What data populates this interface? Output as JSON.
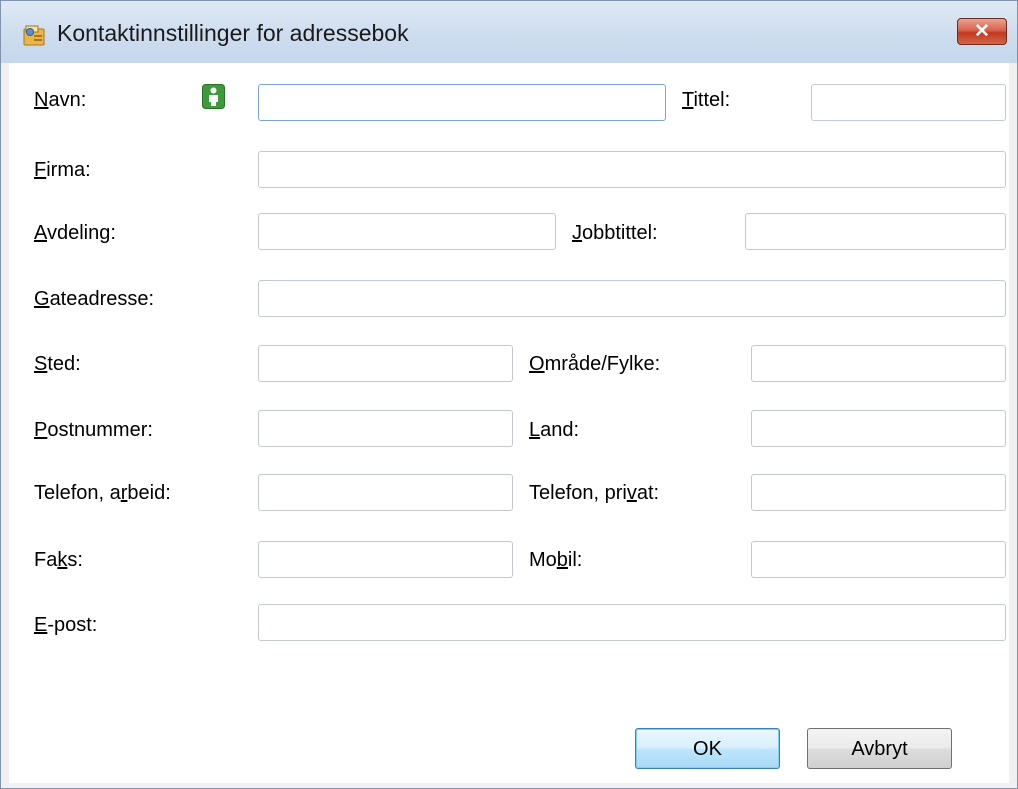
{
  "window": {
    "title": "Kontaktinnstillinger for adressebok",
    "close_label": "✕",
    "title_icon": "address-book-icon"
  },
  "form": {
    "navn": {
      "pre": "",
      "acc": "N",
      "post": "avn:"
    },
    "tittel": {
      "pre": "",
      "acc": "T",
      "post": "ittel:"
    },
    "firma": {
      "pre": "",
      "acc": "F",
      "post": "irma:"
    },
    "avdeling": {
      "pre": "",
      "acc": "A",
      "post": "vdeling:"
    },
    "jobbtittel": {
      "pre": "",
      "acc": "J",
      "post": "obbtittel:"
    },
    "gateadresse": {
      "pre": "",
      "acc": "G",
      "post": "ateadresse:"
    },
    "sted": {
      "pre": "",
      "acc": "S",
      "post": "ted:"
    },
    "omrade": {
      "pre": "",
      "acc": "O",
      "post": "mråde/Fylke:"
    },
    "postnummer": {
      "pre": "",
      "acc": "P",
      "post": "ostnummer:"
    },
    "land": {
      "pre": "",
      "acc": "L",
      "post": "and:"
    },
    "tlf_arbeid": {
      "pre": "Telefon, a",
      "acc": "r",
      "post": "beid:"
    },
    "tlf_privat": {
      "pre": "Telefon, pri",
      "acc": "v",
      "post": "at:"
    },
    "faks": {
      "pre": "Fa",
      "acc": "k",
      "post": "s:"
    },
    "mobil": {
      "pre": "Mo",
      "acc": "b",
      "post": "il:"
    },
    "epost": {
      "pre": "",
      "acc": "E",
      "post": "-post:"
    },
    "values": {
      "navn": "",
      "tittel": "",
      "firma": "",
      "avdeling": "",
      "jobbtittel": "",
      "gateadresse": "",
      "sted": "",
      "omrade": "",
      "postnummer": "",
      "land": "",
      "tlf_arbeid": "",
      "tlf_privat": "",
      "faks": "",
      "mobil": "",
      "epost": ""
    },
    "contact_icon": "person-icon"
  },
  "buttons": {
    "ok": "OK",
    "cancel": "Avbryt"
  }
}
